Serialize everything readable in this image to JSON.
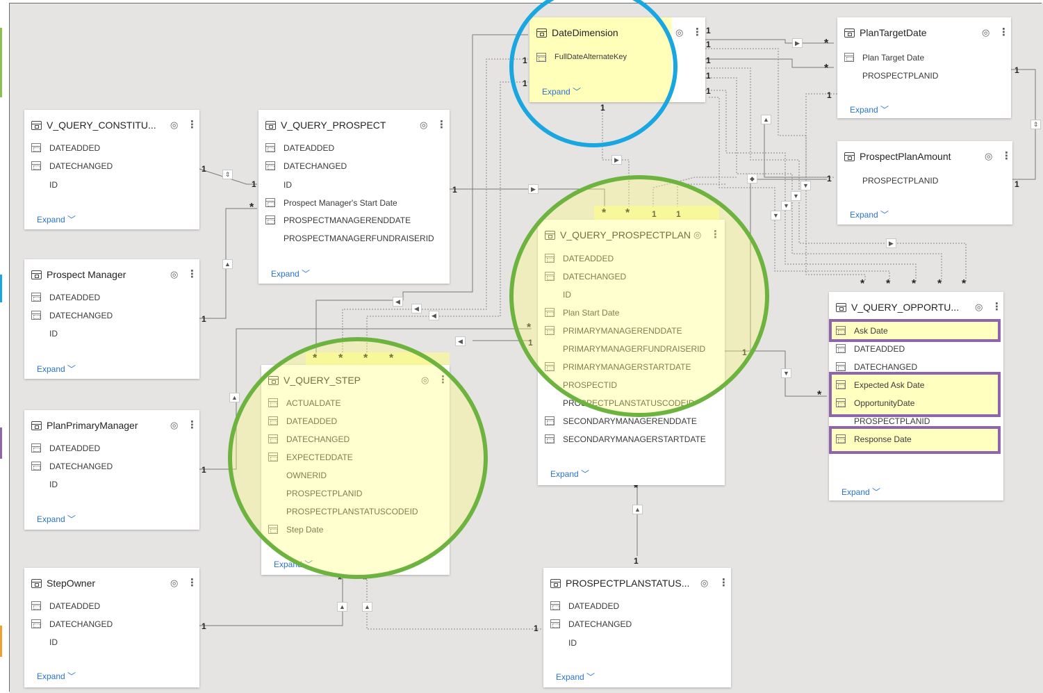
{
  "tables": {
    "date_dimension": {
      "name": "DateDimension",
      "fields": [
        "FullDateAlternateKey"
      ],
      "expand": "Expand"
    },
    "plan_target_date": {
      "name": "PlanTargetDate",
      "fields": [
        "Plan Target Date",
        "PROSPECTPLANID"
      ],
      "expand": "Expand"
    },
    "v_query_constitu": {
      "name": "V_QUERY_CONSTITU...",
      "fields": [
        "DATEADDED",
        "DATECHANGED",
        "ID"
      ],
      "expand": "Expand"
    },
    "v_query_prospect": {
      "name": "V_QUERY_PROSPECT",
      "fields": [
        "DATEADDED",
        "DATECHANGED",
        "ID",
        "Prospect Manager's Start Date",
        "PROSPECTMANAGERENDDATE",
        "PROSPECTMANAGERFUNDRAISERID"
      ],
      "expand": "Expand"
    },
    "prospect_plan_amount": {
      "name": "ProspectPlanAmount",
      "fields": [
        "PROSPECTPLANID"
      ],
      "expand": "Expand"
    },
    "prospect_manager": {
      "name": "Prospect Manager",
      "fields": [
        "DATEADDED",
        "DATECHANGED",
        "ID"
      ],
      "expand": "Expand"
    },
    "v_query_prospectplan": {
      "name": "V_QUERY_PROSPECTPLAN",
      "fields": [
        "DATEADDED",
        "DATECHANGED",
        "ID",
        "Plan Start Date",
        "PRIMARYMANAGERENDDATE",
        "PRIMARYMANAGERFUNDRAISERID",
        "PRIMARYMANAGERSTARTDATE",
        "PROSPECTID",
        "PROSPECTPLANSTATUSCODEID",
        "SECONDARYMANAGERENDDATE",
        "SECONDARYMANAGERSTARTDATE"
      ],
      "expand": "Expand"
    },
    "v_query_opportu": {
      "name": "V_QUERY_OPPORTU...",
      "fields": [
        "Ask Date",
        "DATEADDED",
        "DATECHANGED",
        "Expected Ask Date",
        "OpportunityDate",
        "PROSPECTPLANID",
        "Response Date"
      ],
      "expand": "Expand"
    },
    "v_query_step": {
      "name": "V_QUERY_STEP",
      "fields": [
        "ACTUALDATE",
        "DATEADDED",
        "DATECHANGED",
        "EXPECTEDDATE",
        "OWNERID",
        "PROSPECTPLANID",
        "PROSPECTPLANSTATUSCODEID",
        "Step Date"
      ],
      "expand": "Expand"
    },
    "plan_primary_manager": {
      "name": "PlanPrimaryManager",
      "fields": [
        "DATEADDED",
        "DATECHANGED",
        "ID"
      ],
      "expand": "Expand"
    },
    "step_owner": {
      "name": "StepOwner",
      "fields": [
        "DATEADDED",
        "DATECHANGED",
        "ID"
      ],
      "expand": "Expand"
    },
    "prospectplanstatus": {
      "name": "PROSPECTPLANSTATUS...",
      "fields": [
        "DATEADDED",
        "DATECHANGED",
        "ID"
      ],
      "expand": "Expand"
    }
  },
  "cardinality": {
    "one": "1",
    "many": "*"
  },
  "colors": {
    "canvas": "#e6e4e2",
    "highlight": "#ffff82",
    "circle_blue": "#1aa7e0",
    "circle_green": "#6db33f",
    "box_purple": "#8e64ad",
    "link": "#2b74c8"
  }
}
